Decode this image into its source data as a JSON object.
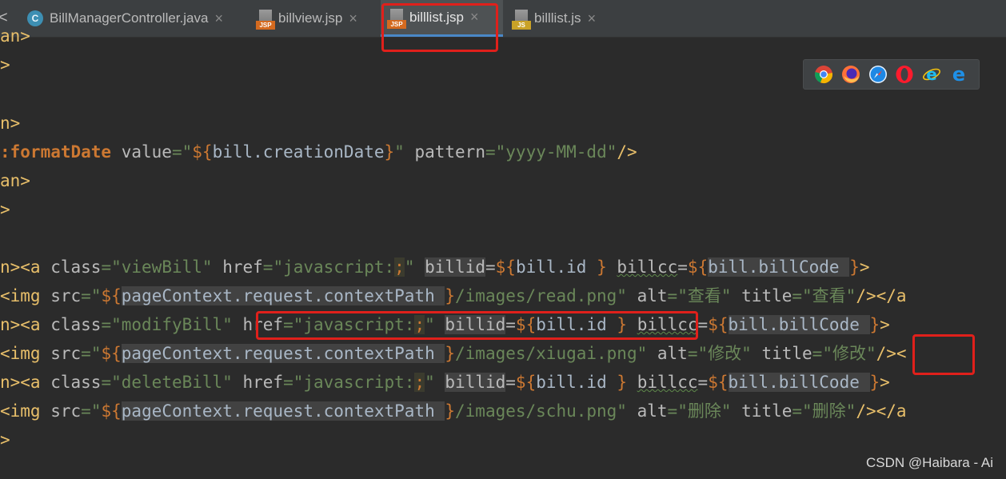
{
  "tabs": [
    {
      "label": "BillManagerController.java",
      "type": "java",
      "active": false
    },
    {
      "label": "billview.jsp",
      "type": "jsp",
      "active": false
    },
    {
      "label": "billlist.jsp",
      "type": "jsp",
      "active": true
    },
    {
      "label": "billlist.js",
      "type": "js",
      "active": false
    }
  ],
  "icons": {
    "java": "C",
    "jsp": "JSP",
    "js": "JS",
    "close": "×",
    "left_chevron": "<"
  },
  "code": {
    "l0": "an>",
    "l1": ">",
    "l3": "n>",
    "l4_tag": ":formatDate",
    "l4_attr1": "value",
    "l4_val1a": "\"",
    "l4_el1": "${",
    "l4_expr1": "bill.creationDate",
    "l4_el1b": "}",
    "l4_val1b": "\"",
    "l4_attr2": "pattern",
    "l4_val2": "\"yyyy-MM-dd\"",
    "l4_end": "/>",
    "l5": "an>",
    "l6": ">",
    "l8_open": "n><a",
    "l8_attr1": "class",
    "l8_val1": "\"viewBill\"",
    "l8_attr2": "href",
    "l8_val2a": "\"javascript:",
    "l8_semi": ";",
    "l8_val2b": "\"",
    "l8_attr3": "billid",
    "l8_el1": "${",
    "l8_expr1": "bill.id ",
    "l8_el1b": "}",
    "l8_attr4": "billcc",
    "l8_el2": "${",
    "l8_expr2": "bill.billCode ",
    "l8_el2b": "}",
    "l8_end": ">",
    "l9_open": "<img",
    "l9_attr1": "src",
    "l9_val1a": "\"",
    "l9_el": "${",
    "l9_expr": "pageContext.request.contextPath ",
    "l9_elb": "}",
    "l9_val1b": "/images/read.png\"",
    "l9_attr2": "alt",
    "l9_val2": "\"查看\"",
    "l9_attr3": "title",
    "l9_val3": "\"查看\"",
    "l9_end": "/></a",
    "l10_open": "n><a",
    "l10_attr1": "class",
    "l10_val1": "\"modifyBill\"",
    "l10_attr2": "href",
    "l10_val2a": "\"javascript:",
    "l10_semi": ";",
    "l10_val2b": "\"",
    "l10_attr3": "billid",
    "l10_el1": "${",
    "l10_expr1": "bill.id ",
    "l10_el1b": "}",
    "l10_attr4": "billcc",
    "l10_el2": "${",
    "l10_expr2": "bill.billCode ",
    "l10_el2b": "}",
    "l10_end": ">",
    "l11_open": "<img",
    "l11_attr1": "src",
    "l11_val1a": "\"",
    "l11_el": "${",
    "l11_expr": "pageContext.request.contextPath ",
    "l11_elb": "}",
    "l11_val1b": "/images/xiugai.png\"",
    "l11_attr2": "alt",
    "l11_val2": "\"修改\"",
    "l11_attr3": "title",
    "l11_val3q": "\"",
    "l11_val3": "修改",
    "l11_val3q2": "\"",
    "l11_end": "/><",
    "l12_open": "n><a",
    "l12_attr1": "class",
    "l12_val1": "\"deleteBill\"",
    "l12_attr2": "href",
    "l12_val2a": "\"javascript:",
    "l12_semi": ";",
    "l12_val2b": "\"",
    "l12_attr3": "billid",
    "l12_el1": "${",
    "l12_expr1": "bill.id ",
    "l12_el1b": "}",
    "l12_attr4": "billcc",
    "l12_el2": "${",
    "l12_expr2": "bill.billCode ",
    "l12_el2b": "}",
    "l12_end": ">",
    "l13_open": "<img",
    "l13_attr1": "src",
    "l13_val1a": "\"",
    "l13_el": "${",
    "l13_expr": "pageContext.request.contextPath ",
    "l13_elb": "}",
    "l13_val1b": "/images/schu.png\"",
    "l13_attr2": "alt",
    "l13_val2": "\"删除\"",
    "l13_attr3": "title",
    "l13_val3": "\"删除\"",
    "l13_end": "/></a",
    "l14": ">",
    "eq": "="
  },
  "browsers": [
    "chrome-icon",
    "firefox-icon",
    "safari-icon",
    "opera-icon",
    "ie-icon",
    "edge-icon"
  ],
  "colors": {
    "highlight_box": "#e0201b",
    "tab_accent": "#4a88c7"
  },
  "watermark": "CSDN @Haibara - Ai"
}
